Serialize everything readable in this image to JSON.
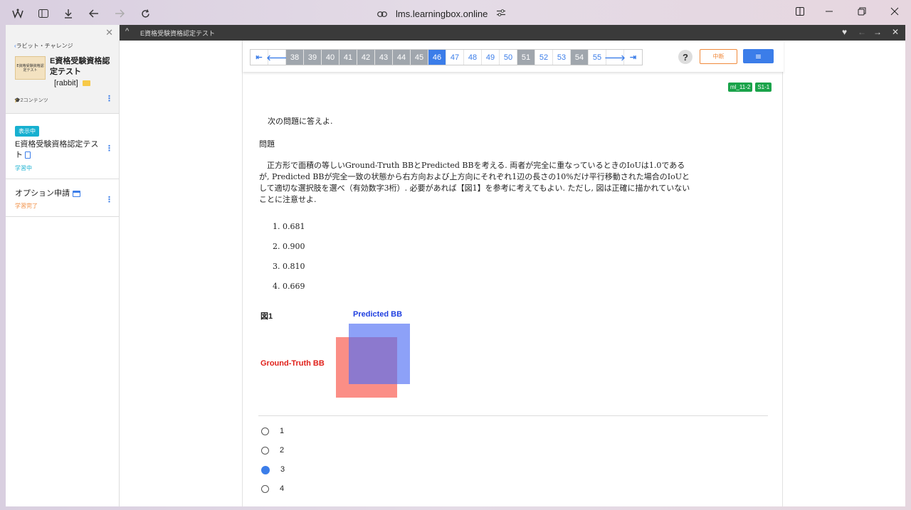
{
  "browser": {
    "url": "lms.learningbox.online"
  },
  "sidebar": {
    "back_label": "ラビット・チャレンジ",
    "course_title": "E資格受験資格認定テスト",
    "course_tag": "[rabbit]",
    "thumb_text": "E資格受験資格認定テスト",
    "content_count": "2コンテンツ",
    "items": [
      {
        "badge": "表示中",
        "title": "E資格受験資格認定テスト",
        "status": "学習中",
        "status_color": "#17b0d0"
      },
      {
        "title": "オプション申請",
        "status": "学習完了",
        "status_color": "#f08a3c"
      }
    ]
  },
  "topbar": {
    "title": "E資格受験資格認定テスト"
  },
  "pager": {
    "pages": [
      "38",
      "39",
      "40",
      "41",
      "42",
      "43",
      "44",
      "45",
      "46",
      "47",
      "48",
      "49",
      "50",
      "51",
      "52",
      "53",
      "54",
      "55"
    ],
    "current": "46",
    "visited": [
      "38",
      "39",
      "40",
      "41",
      "42",
      "43",
      "44",
      "45",
      "51",
      "54"
    ]
  },
  "toolbar": {
    "help_label": "?",
    "suspend_label": "中断",
    "menu_label": "≡"
  },
  "tags": [
    "ml_11-2",
    "S1-1"
  ],
  "question": {
    "intro": "次の問題に答えよ.",
    "heading": "問題",
    "body": "正方形で面積の等しいGround-Truth BBとPredicted BBを考える. 両者が完全に重なっているときのIoUは1.0であるが, Predicted BBが完全一致の状態から右方向および上方向にそれぞれ1辺の長さの10%だけ平行移動された場合のIoUとして適切な選択肢を選べ（有効数字3桁）. 必要があれば【図1】を参考に考えてもよい. ただし, 図は正確に描かれていないことに注意せよ.",
    "choices": [
      "1.  0.681",
      "2.  0.900",
      "3.  0.810",
      "4.  0.669"
    ]
  },
  "figure": {
    "label": "図1",
    "predicted_label": "Predicted BB",
    "gt_label": "Ground-Truth BB",
    "gt_color": "#fa6e64",
    "pred_color": "#506ef5"
  },
  "answers": {
    "options": [
      "1",
      "2",
      "3",
      "4"
    ],
    "selected": "3"
  },
  "colors": {
    "accent": "#3b7de9",
    "tag_green": "#1aa34a",
    "suspend_orange": "#f08a3c"
  }
}
